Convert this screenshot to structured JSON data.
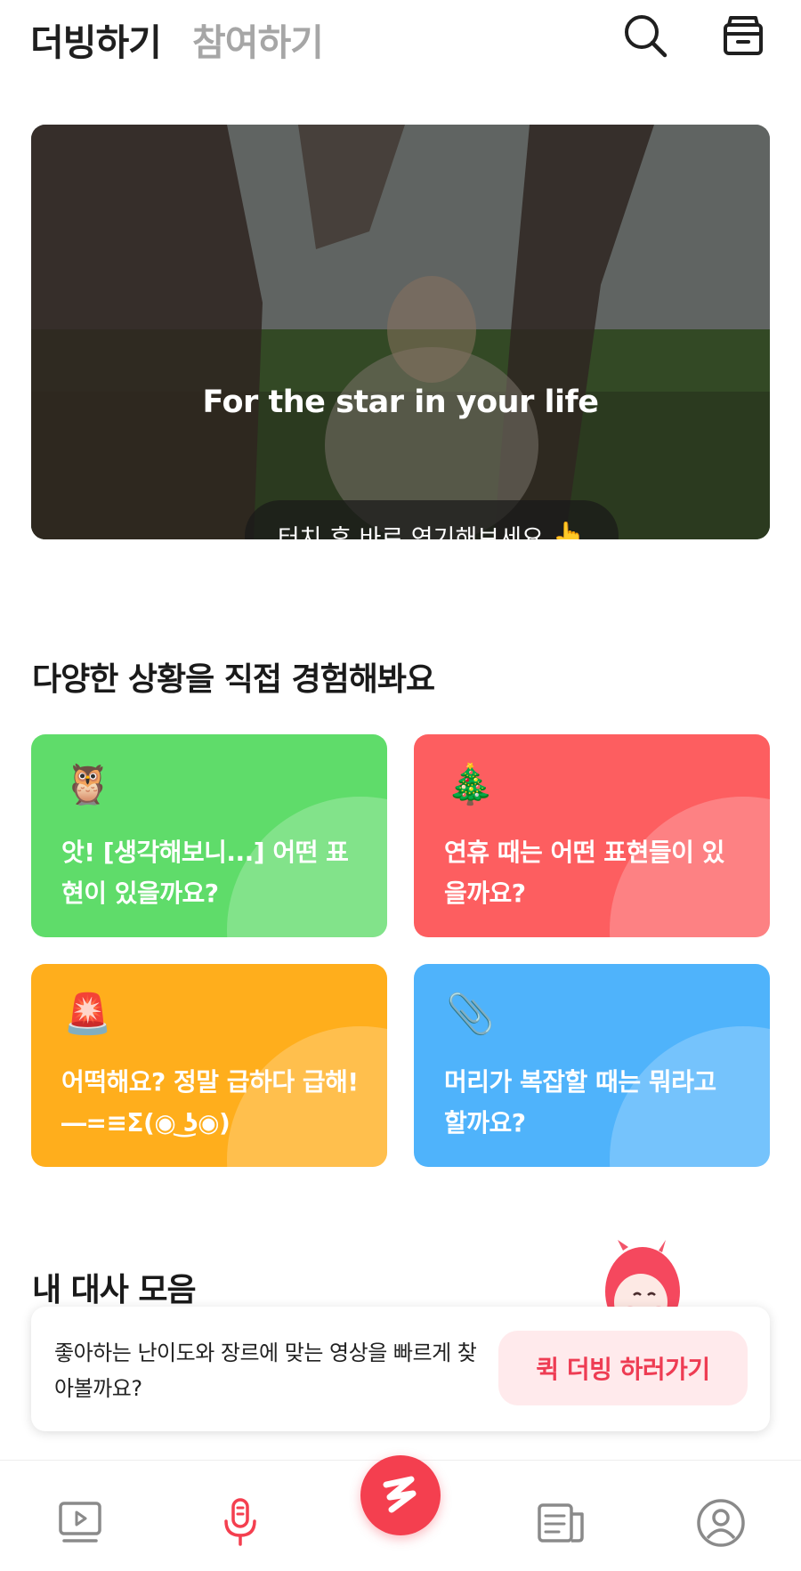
{
  "header": {
    "tab_dubbing": "더빙하기",
    "tab_join": "참여하기",
    "search_icon": "search-icon",
    "box_icon": "archive-box-icon"
  },
  "hero": {
    "title": "For the star in your life",
    "pill_text": "터치 후 바로 연기해보세요",
    "pill_emoji": "👆"
  },
  "situations": {
    "title": "다양한 상황을 직접 경험해봐요",
    "cards": [
      {
        "emoji": "🦉",
        "text": "앗! [생각해보니...] 어떤 표현이 있을까요?",
        "color": "#5fdc6a"
      },
      {
        "emoji": "🎄",
        "text": "연휴 때는 어떤 표현들이 있을까요?",
        "color": "#fd5e60"
      },
      {
        "emoji": "🚨",
        "text": "어떡해요? 정말 급하다 급해! ―=≡Σ(◉ ͜ʖ◉)",
        "color": "#ffae1c"
      },
      {
        "emoji": "📎",
        "text": "머리가 복잡할 때는 뭐라고 할까요?",
        "color": "#4fb3fb"
      }
    ]
  },
  "my_lines": {
    "title": "내 대사 모음"
  },
  "banner": {
    "text": "좋아하는 난이도와 장르에 맞는 영상을 빠르게 찾아볼까요?",
    "button_label": "퀵 더빙 하러가기"
  },
  "bottom_nav": {
    "items": [
      "video-icon",
      "microphone-icon",
      "dubbing-fab-icon",
      "news-icon",
      "profile-icon"
    ],
    "active_color": "#f43f4f",
    "inactive_color": "#8a8a8a"
  }
}
